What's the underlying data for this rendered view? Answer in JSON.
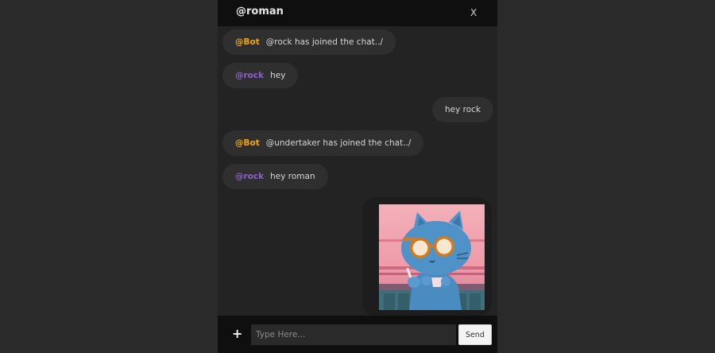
{
  "chat": {
    "title": "@roman",
    "close_label": "X"
  },
  "messages": [
    {
      "sender": "@Bot",
      "sender_color": "#f0a70d",
      "text": "@rock has joined the chat../",
      "side": "left"
    },
    {
      "sender": "@rock",
      "sender_color": "#8b5fc9",
      "text": "hey",
      "side": "left"
    },
    {
      "sender": "",
      "text": "hey rock",
      "side": "right"
    },
    {
      "sender": "@Bot",
      "sender_color": "#f0a70d",
      "text": "@undertaker has joined the chat../",
      "side": "left"
    },
    {
      "sender": "@rock",
      "sender_color": "#8b5fc9",
      "text": "hey roman",
      "side": "left"
    }
  ],
  "image_message": {
    "side": "right",
    "content": "cat-with-sunglasses-image"
  },
  "composer": {
    "add_label": "+",
    "placeholder": "Type Here...",
    "value": "",
    "send_label": "Send"
  }
}
